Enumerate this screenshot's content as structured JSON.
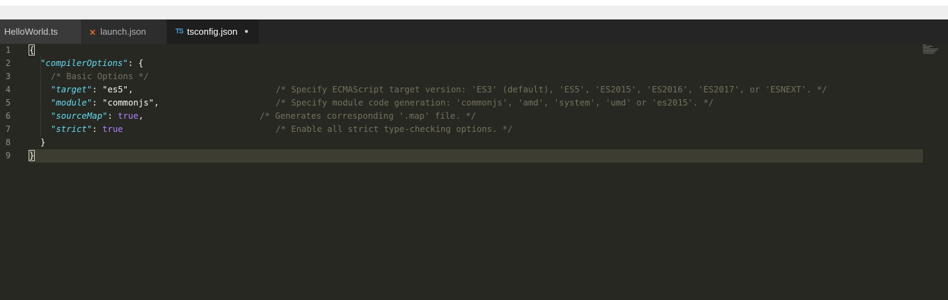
{
  "tabs": [
    {
      "label": "HelloWorld.ts",
      "icon": "",
      "active": false
    },
    {
      "label": "launch.json",
      "icon": "vscode-icon",
      "active": false
    },
    {
      "label": "tsconfig.json",
      "icon": "typescript-icon",
      "active": true,
      "dirty_marker": "●"
    }
  ],
  "editor": {
    "line_numbers": [
      "1",
      "2",
      "3",
      "4",
      "5",
      "6",
      "7",
      "8",
      "9"
    ],
    "lines": {
      "l1": {
        "open": "{"
      },
      "l2": {
        "key": "\"compilerOptions\"",
        "rest": ": {"
      },
      "l3": {
        "comment": "/* Basic Options */"
      },
      "l4": {
        "key": "\"target\"",
        "colon": ": ",
        "value": "\"es5\"",
        "tail": ",",
        "comment": "/* Specify ECMAScript target version: 'ES3' (default), 'ES5', 'ES2015', 'ES2016', 'ES2017', or 'ESNEXT'. */"
      },
      "l5": {
        "key": "\"module\"",
        "colon": ": ",
        "value": "\"commonjs\"",
        "tail": ",",
        "comment": "/* Specify module code generation: 'commonjs', 'amd', 'system', 'umd' or 'es2015'. */"
      },
      "l6": {
        "key": "\"sourceMap\"",
        "colon": ": ",
        "value": "true",
        "tail": ",",
        "comment": "/* Generates corresponding '.map' file. */"
      },
      "l7": {
        "key": "\"strict\"",
        "colon": ": ",
        "value": "true",
        "comment": "/* Enable all strict type-checking options. */"
      },
      "l8": {
        "close": "}"
      },
      "l9": {
        "close": "}"
      }
    }
  },
  "colors": {
    "background": "#272822",
    "key": "#66d9ef",
    "keyword": "#ae81ff",
    "comment": "#75715e",
    "current_line": "#3e3d32"
  }
}
